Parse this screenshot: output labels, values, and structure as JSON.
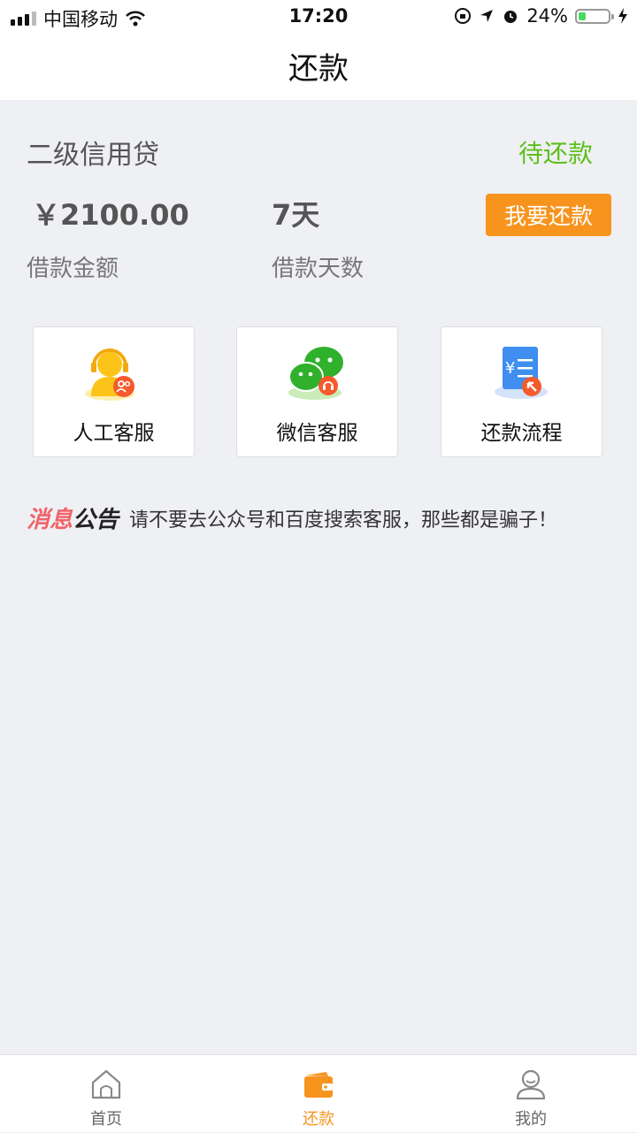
{
  "status_bar": {
    "carrier": "中国移动",
    "time": "17:20",
    "battery": "24%",
    "icons": [
      "signal-icon",
      "wifi-icon",
      "rotation-lock-icon",
      "location-icon",
      "alarm-icon",
      "battery-icon",
      "charging-icon"
    ]
  },
  "nav": {
    "title": "还款"
  },
  "loan": {
    "title": "二级信用贷",
    "status": "待还款",
    "amount": "￥2100.00",
    "amount_label": "借款金额",
    "days": "7天",
    "days_label": "借款天数",
    "repay_button": "我要还款"
  },
  "services": [
    {
      "label": "人工客服",
      "icon": "customer-service-icon"
    },
    {
      "label": "微信客服",
      "icon": "wechat-icon"
    },
    {
      "label": "还款流程",
      "icon": "repayment-process-icon"
    }
  ],
  "notice": {
    "tag_part1": "消息",
    "tag_part2": "公告",
    "text": "请不要去公众号和百度搜索客服，那些都是骗子！"
  },
  "tabs": [
    {
      "label": "首页",
      "icon": "home-icon",
      "active": false
    },
    {
      "label": "还款",
      "icon": "wallet-icon",
      "active": true
    },
    {
      "label": "我的",
      "icon": "user-icon",
      "active": false
    }
  ],
  "colors": {
    "accent": "#f7941e",
    "status_green": "#5cbf1a",
    "notice_red": "#f06368",
    "background": "#eff0f4"
  }
}
